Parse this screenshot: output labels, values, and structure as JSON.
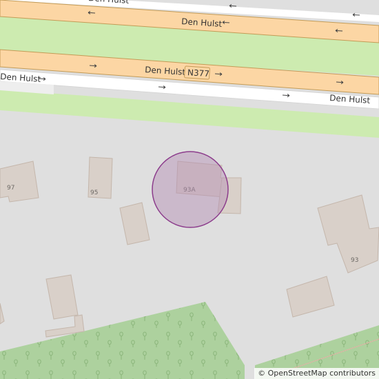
{
  "map": {
    "roads": [
      {
        "name": "Den Hulst",
        "ref": "N377"
      }
    ],
    "houses": [
      {
        "number": "97"
      },
      {
        "number": "95"
      },
      {
        "number": "93A"
      },
      {
        "number": "93"
      }
    ],
    "colors": {
      "background": "#dfdfdf",
      "road_primary": "#fcd6a4",
      "road_primary_casing": "#c39b56",
      "road_minor": "#ffffff",
      "grass": "#cdebb0",
      "park": "#add19e",
      "building": "#d9d0c9",
      "building_outline": "#c4b6ab",
      "marker_fill": "#b48cb4",
      "marker_stroke": "#8c3c8c"
    },
    "marker": {
      "icon": "location-circle-marker",
      "label": "93A"
    }
  },
  "attribution": {
    "symbol": "©",
    "text": "OpenStreetMap contributors"
  }
}
